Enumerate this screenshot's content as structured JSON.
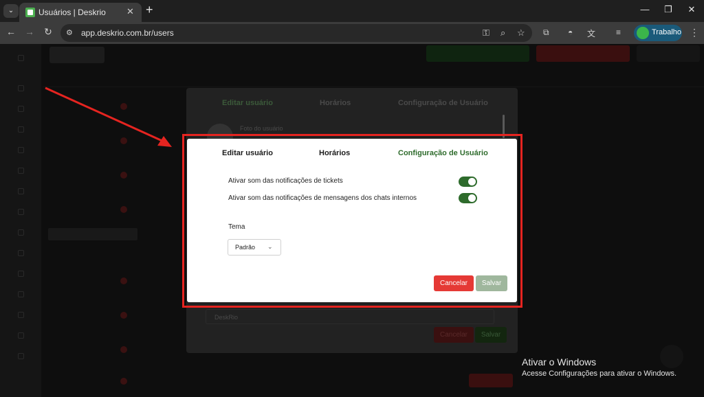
{
  "browser": {
    "tab_title": "Usuários | Deskrio",
    "url": "app.deskrio.com.br/users",
    "profile_label": "Trabalho"
  },
  "modal": {
    "tabs": [
      {
        "label": "Editar usuário",
        "active": false
      },
      {
        "label": "Horários",
        "active": false
      },
      {
        "label": "Configuração de Usuário",
        "active": true
      }
    ],
    "settings": [
      {
        "label": "Ativar som das notificações de tickets",
        "enabled": true
      },
      {
        "label": "Ativar som das notificações de mensagens dos chats internos",
        "enabled": true
      }
    ],
    "theme_label": "Tema",
    "theme_value": "Padrão",
    "cancel_label": "Cancelar",
    "save_label": "Salvar"
  },
  "background_modal": {
    "tabs": [
      "Editar usuário",
      "Horários",
      "Configuração de Usuário"
    ],
    "photo_label": "Foto do usuário",
    "select_value": "DeskRio",
    "cancel_label": "Cancelar",
    "save_label": "Salvar"
  },
  "watermark": {
    "title": "Ativar o Windows",
    "subtitle": "Acesse Configurações para ativar o Windows."
  },
  "colors": {
    "accent_green": "#2e6b2c",
    "cancel_red": "#e53935",
    "annotation_red": "#e52420"
  }
}
